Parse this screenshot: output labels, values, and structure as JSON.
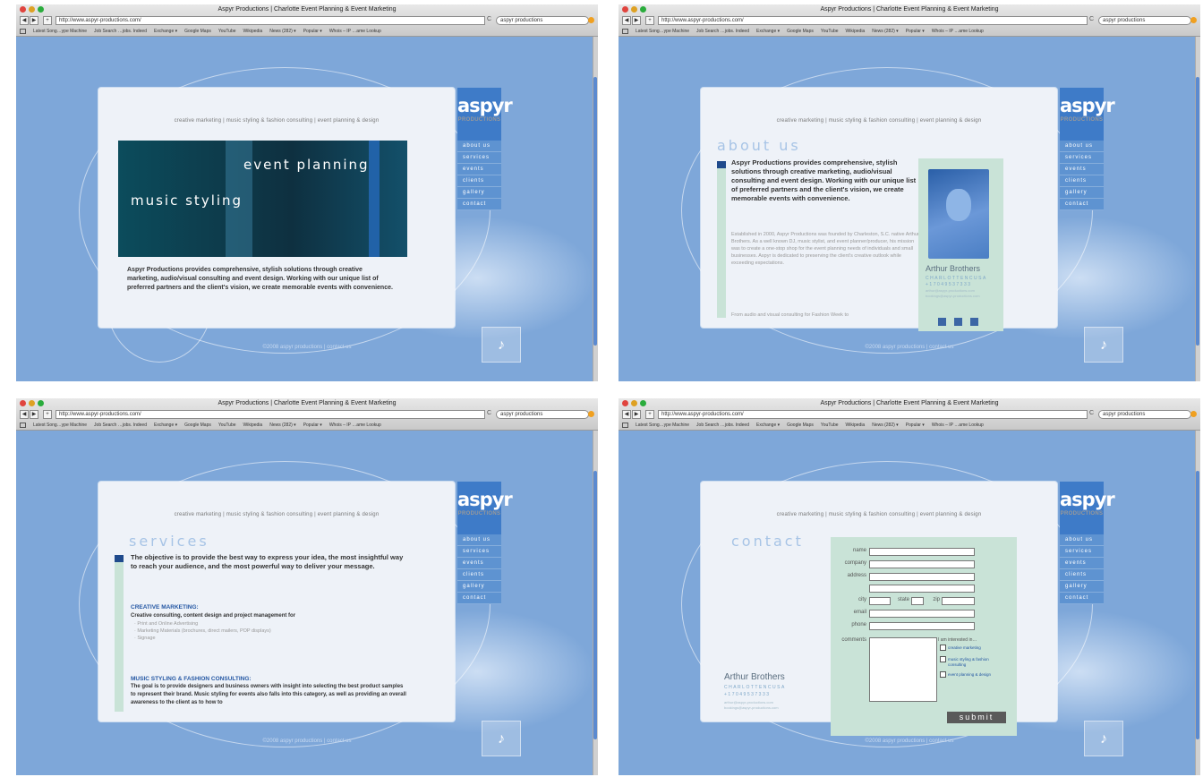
{
  "browser": {
    "window_title": "Aspyr Productions | Charlotte Event Planning & Event Marketing",
    "url": "http://www.aspyr-productions.com/",
    "search_value": "aspyr productions",
    "bookmarks": [
      "Latest Song…ype Machine",
      "Job Search …jobs. Indeed",
      "Exchange ▾",
      "Google Maps",
      "YouTube",
      "Wikipedia",
      "News (282) ▾",
      "Popular ▾",
      "Whois – IP …ame Lookup"
    ]
  },
  "site": {
    "top_nav": "creative marketing  |  music styling & fashion consulting  |  event planning & design",
    "logo_main": "aspyr",
    "logo_sub": "PRODUCTIONS",
    "side_nav": [
      "about us",
      "services",
      "events",
      "clients",
      "gallery",
      "contact"
    ],
    "footer": "©2008 aspyr productions | contact us",
    "note_glyph": "♪"
  },
  "home": {
    "hero_line1": "event planning",
    "hero_line2": "music styling",
    "intro": "Aspyr Productions provides comprehensive, stylish solutions through creative marketing, audio/visual consulting and event design. Working with our unique list of preferred partners and the client's vision, we create memorable events with convenience."
  },
  "about": {
    "heading": "about us",
    "lead": "Aspyr Productions provides comprehensive, stylish solutions through creative marketing, audio/visual consulting and event design. Working with our unique list of preferred partners and the client's vision, we create memorable events with convenience.",
    "body": "Established in 2000, Aspyr Productions was founded by Charleston, S.C. native Arthur Brothers. As a well known DJ, music stylist, and event planner/producer, his mission was to create a one-stop shop for the event planning needs of individuals and small businesses. Aspyr is dedicated to preserving the client's creative outlook while exceeding expectations.",
    "body2": "From audio and visual consulting for Fashion Week to",
    "person": "Arthur Brothers",
    "city": "CHARLOTTENCUSA",
    "phone": "+17049537333",
    "email1": "arthur@aspyr-productions.com",
    "email2": "bookings@aspyr-productions.com"
  },
  "services": {
    "heading": "services",
    "lead": "The objective is to provide the best way to express your idea, the most insightful way to reach your audience, and the most powerful way to deliver your message.",
    "sect1": "CREATIVE MARKETING:",
    "sect1_body": "Creative consulting, content design and project management for",
    "sect1_items": [
      "· Print and Online Advertising",
      "· Marketing Materials (brochures, direct mailers, POP displays)",
      "· Signage"
    ],
    "sect2": "MUSIC STYLING & FASHION CONSULTING:",
    "sect2_body": "The goal is to provide designers and business owners with insight into selecting the best product samples to represent their brand. Music styling for events also falls into this category, as well as providing an overall awareness to the client as to how to"
  },
  "contact": {
    "heading": "contact",
    "labels": [
      "name",
      "company",
      "address",
      "city",
      "state",
      "zip",
      "email",
      "phone",
      "comments"
    ],
    "interest_title": "I am interested in…",
    "interests": [
      "creative marketing",
      "music styling & fashion consulting",
      "event planning & design"
    ],
    "submit": "submit"
  }
}
